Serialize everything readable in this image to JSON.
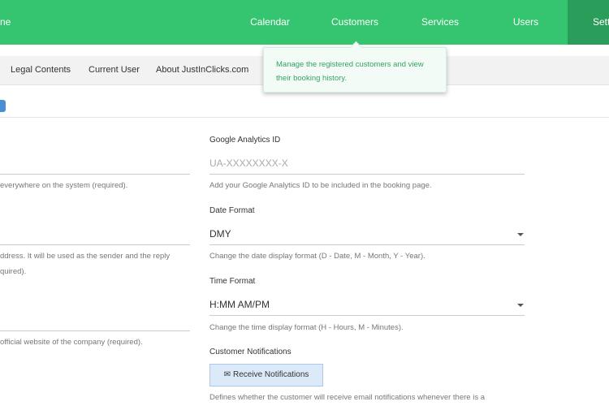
{
  "topnav": {
    "brand_fragment": "ne",
    "items": [
      "Calendar",
      "Customers",
      "Services",
      "Users",
      "Sett"
    ]
  },
  "subnav": {
    "tabs": [
      "Legal Contents",
      "Current User",
      "About JustInClicks.com"
    ]
  },
  "tooltip": {
    "text_line1": "Manage the registered customers and view",
    "text_line2": "their booking history."
  },
  "left_column": {
    "help1": "everywhere on the system (required).",
    "help2_line1": "ddress. It will be used as the sender and the reply",
    "help2_line2": "quired).",
    "help3": "official website of the company (required)."
  },
  "right_column": {
    "analytics": {
      "label": "Google Analytics ID",
      "placeholder": "UA-XXXXXXXX-X",
      "help": "Add your Google Analytics ID to be included in the booking page."
    },
    "date_format": {
      "label": "Date Format",
      "value": "DMY",
      "help": "Change the date display format (D - Date, M - Month, Y - Year)."
    },
    "time_format": {
      "label": "Time Format",
      "value": "H:MM AM/PM",
      "help": "Change the time display format (H - Hours, M - Minutes)."
    },
    "customer_notifications": {
      "label": "Customer Notifications",
      "button_icon": "envelope-icon",
      "button_label": "Receive Notifications",
      "help": "Defines whether the customer will receive email notifications whenever there is a"
    }
  },
  "colors": {
    "nav_green": "#35c46f",
    "nav_active": "#2a9d5a",
    "tooltip_text": "#35a35f",
    "button_blue": "#4a8fd6"
  }
}
